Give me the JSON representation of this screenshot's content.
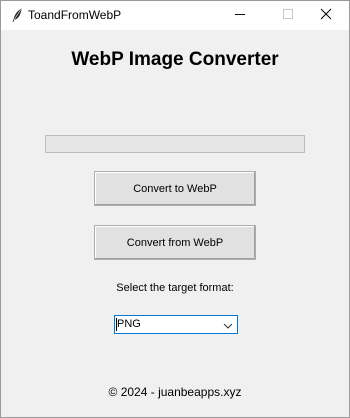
{
  "window": {
    "title": "ToandFromWebP",
    "controls": {
      "minimize_icon": "minimize-icon",
      "maximize_icon": "maximize-icon",
      "close_icon": "close-icon"
    }
  },
  "main": {
    "heading": "WebP Image Converter",
    "progress": 0,
    "buttons": {
      "convert_to": "Convert to WebP",
      "convert_from": "Convert from WebP"
    },
    "format": {
      "label": "Select the target format:",
      "selected": "PNG"
    }
  },
  "footer": {
    "text": "© 2024 - juanbeapps.xyz"
  },
  "colors": {
    "focus_border": "#0078d7",
    "window_background": "#f0f0f0",
    "button_face": "#e1e1e1"
  }
}
